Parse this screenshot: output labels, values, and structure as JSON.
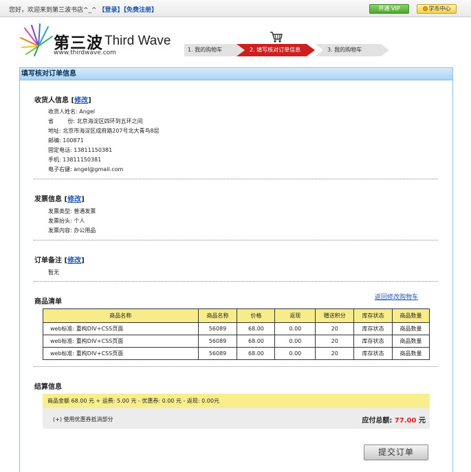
{
  "topbar": {
    "welcome": "您好，欢迎来到第三波书店^_^",
    "login": "【登录】",
    "register": "【免费注册】",
    "vip_button": "开通 VIP",
    "coin_button": "学币中心"
  },
  "logo": {
    "brand_cn": "第三波",
    "brand_en": "Third Wave",
    "url": "www.thirdwave.com"
  },
  "steps": [
    {
      "label": "1. 我的购物车",
      "active": false
    },
    {
      "label": "2. 填写核对订单信息",
      "active": true
    },
    {
      "label": "3. 我的购物车",
      "active": false
    }
  ],
  "panel_title": "填写核对订单信息",
  "receiver": {
    "title": "收货人信息",
    "edit": "修改",
    "lines": [
      "收货人姓名: Angel",
      "省        份: 北京海淀区四环到五环之间",
      "地址: 北京市海淀区成府路207号北大青鸟8层",
      "邮编: 100871",
      "固定电话: 13811150381",
      "手机: 13811150381",
      "电子右键: angel@gmail.com"
    ]
  },
  "invoice": {
    "title": "发票信息",
    "edit": "修改",
    "lines": [
      "发票类型: 普通发票",
      "发票抬头: 个人",
      "发票内容: 办公用品"
    ]
  },
  "remark": {
    "title": "订单备注",
    "edit": "修改",
    "value": "暂无"
  },
  "goods": {
    "title": "商品清单",
    "back_link": "返回修改购物车",
    "headers": [
      "商品名称",
      "商品名称",
      "价格",
      "返现",
      "赠送积分",
      "库存状态",
      "商品数量"
    ],
    "rows": [
      [
        "web标准: 重构DIV+CSS页面",
        "56089",
        "68.00",
        "0.00",
        "20",
        "库存状态",
        "商品数量"
      ],
      [
        "web标准: 重构DIV+CSS页面",
        "56089",
        "68.00",
        "0.00",
        "20",
        "库存状态",
        "商品数量"
      ],
      [
        "web标准: 重构DIV+CSS页面",
        "56089",
        "68.00",
        "0.00",
        "20",
        "库存状态",
        "商品数量"
      ]
    ]
  },
  "settlement": {
    "title": "结算信息",
    "summary": "商品金额 68.00 元 + 运费: 5.00 元 - 优惠券: 0.00 元 - 返现: 0.00元",
    "coupon": "(+) 使用优惠券抵消部分",
    "total_label": "应付总额:",
    "total_amount": "77.00",
    "total_unit": "元"
  },
  "submit_button": "提交订单"
}
